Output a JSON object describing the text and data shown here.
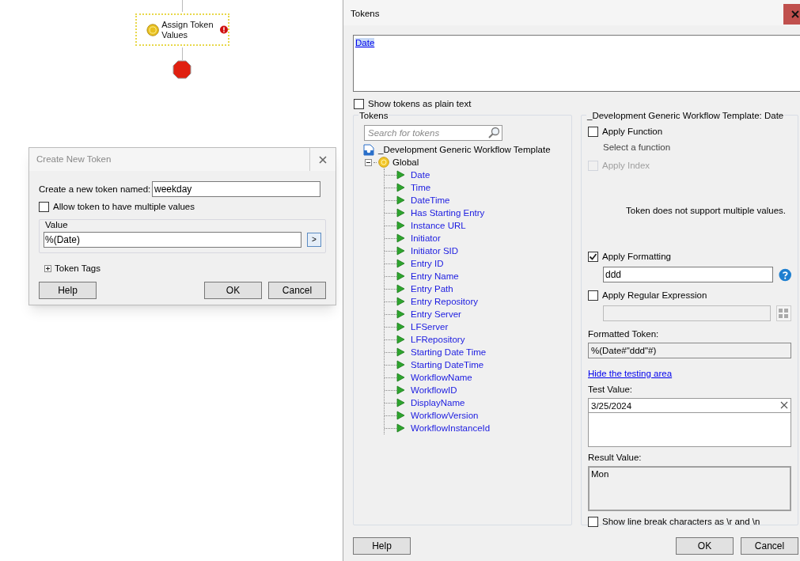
{
  "workflow": {
    "activity": {
      "label": "Assign Token Values",
      "has_error": true
    }
  },
  "create_token_dialog": {
    "title": "Create New Token",
    "name_label": "Create a new token named:",
    "name_value": "weekday",
    "allow_multiple": {
      "label": "Allow token to have multiple values",
      "checked": false
    },
    "value_group": "Value",
    "value": "%(Date)",
    "insert_button": ">",
    "token_tags": {
      "label": "Token Tags",
      "expanded": false
    },
    "buttons": [
      "Help",
      "OK",
      "Cancel"
    ]
  },
  "tokens_dialog": {
    "title": "Tokens",
    "editor_token": "Date",
    "show_plain_text": {
      "label": "Show tokens as plain text",
      "checked": false
    },
    "tokens_group": "Tokens",
    "search": {
      "placeholder": "Search for tokens"
    },
    "tree": [
      {
        "label": "_Development Generic Workflow Template",
        "kind": "template",
        "children": [
          {
            "label": "Global",
            "kind": "group",
            "expanded": true,
            "children": [
              {
                "label": "Date",
                "kind": "token"
              },
              {
                "label": "Time",
                "kind": "token"
              },
              {
                "label": "DateTime",
                "kind": "token"
              },
              {
                "label": "Has Starting Entry",
                "kind": "token"
              },
              {
                "label": "Instance URL",
                "kind": "token"
              },
              {
                "label": "Initiator",
                "kind": "token"
              },
              {
                "label": "Initiator SID",
                "kind": "token"
              },
              {
                "label": "Entry ID",
                "kind": "token"
              },
              {
                "label": "Entry Name",
                "kind": "token"
              },
              {
                "label": "Entry Path",
                "kind": "token"
              },
              {
                "label": "Entry Repository",
                "kind": "token"
              },
              {
                "label": "Entry Server",
                "kind": "token"
              },
              {
                "label": "LFServer",
                "kind": "token"
              },
              {
                "label": "LFRepository",
                "kind": "token"
              },
              {
                "label": "Starting Date Time",
                "kind": "token"
              },
              {
                "label": "Starting DateTime",
                "kind": "token"
              },
              {
                "label": "WorkflowName",
                "kind": "token"
              },
              {
                "label": "WorkflowID",
                "kind": "token"
              },
              {
                "label": "DisplayName",
                "kind": "token"
              },
              {
                "label": "WorkflowVersion",
                "kind": "token"
              },
              {
                "label": "WorkflowInstanceId",
                "kind": "token"
              }
            ]
          }
        ]
      }
    ],
    "details_title": "_Development Generic Workflow Template: Date",
    "apply_function": {
      "label": "Apply Function",
      "checked": false,
      "hint": "Select a function"
    },
    "apply_index": {
      "label": "Apply Index",
      "checked": false,
      "disabled": true
    },
    "multiple_note": "Token does not support multiple values.",
    "apply_formatting": {
      "label": "Apply Formatting",
      "checked": true,
      "value": "ddd"
    },
    "apply_regex": {
      "label": "Apply Regular Expression",
      "checked": false,
      "field_disabled": true
    },
    "formatted_token": {
      "label": "Formatted Token:",
      "value": "%(Date#\"ddd\"#)"
    },
    "testing_link": "Hide the testing area",
    "test_value": {
      "label": "Test Value:",
      "value": "3/25/2024"
    },
    "result_value": {
      "label": "Result Value:",
      "value": "Mon"
    },
    "show_line_breaks": {
      "label": "Show line break characters as \\r and \\n",
      "checked": false
    },
    "buttons": [
      "Help",
      "OK",
      "Cancel"
    ]
  }
}
